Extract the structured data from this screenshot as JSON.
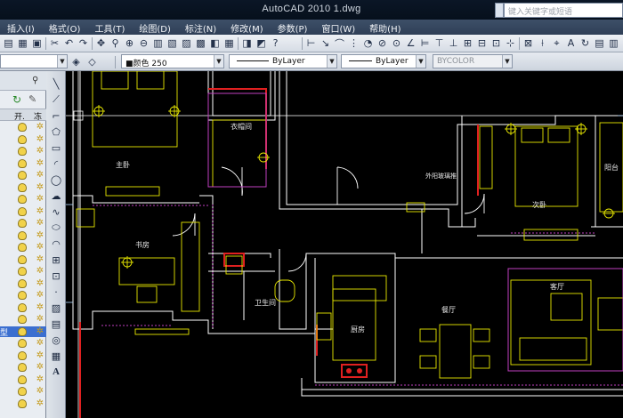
{
  "window": {
    "title": "AutoCAD 2010    1.dwg",
    "search_placeholder": "键入关键字或短语"
  },
  "menu": [
    "插入(I)",
    "格式(O)",
    "工具(T)",
    "绘图(D)",
    "标注(N)",
    "修改(M)",
    "参数(P)",
    "窗口(W)",
    "帮助(H)"
  ],
  "properties": {
    "color_label": "■颜色 250",
    "linetype_label": "ByLayer",
    "lineweight_label": "ByLayer",
    "plotstyle_label": "BYCOLOR"
  },
  "layer_panel": {
    "header_on": "开.",
    "header_freeze": "冻",
    "selected_fragment": "型"
  },
  "rooms": {
    "master_bedroom": "主卧",
    "cloakroom": "衣帽间",
    "study": "书房",
    "bathroom": "卫生间",
    "kitchen": "厨房",
    "dining": "餐厅",
    "living": "客厅",
    "second_bedroom": "次卧",
    "balcony": "阳台",
    "outdoor_window": "外阳玻璃推"
  },
  "colors": {
    "canvas_bg": "#000000",
    "wall": "#ffffff",
    "furniture": "#e8e800",
    "accent_red": "#e02020",
    "hatch_magenta": "#c040c0",
    "menu_bg": "#34455e",
    "title_bg": "#0b1626"
  }
}
